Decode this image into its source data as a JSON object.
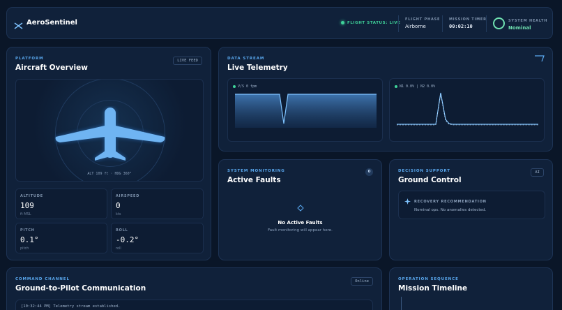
{
  "header": {
    "brand": "AeroSentinel",
    "flight_status": "FLIGHT STATUS: LIVE",
    "flight_phase_label": "FLIGHT PHASE",
    "flight_phase_value": "Airborne",
    "mission_timer_label": "MISSION TIMER",
    "mission_timer_value": "00:02:10",
    "system_health_label": "SYSTEM HEALTH",
    "system_health_value": "Nominal"
  },
  "aircraft": {
    "eyebrow": "PLATFORM",
    "title": "Aircraft Overview",
    "badge": "LIVE FEED",
    "readout": "ALT 109 ft · HDG 360°",
    "stats": [
      {
        "label": "ALTITUDE",
        "value": "109",
        "unit": "ft MSL"
      },
      {
        "label": "AIRSPEED",
        "value": "0",
        "unit": "kts"
      },
      {
        "label": "PITCH",
        "value": "0.1°",
        "unit": "pitch"
      },
      {
        "label": "ROLL",
        "value": "-0.2°",
        "unit": "roll"
      }
    ]
  },
  "telemetry": {
    "eyebrow": "DATA STREAM",
    "title": "Live Telemetry",
    "vs_label": "V/S 0 fpm",
    "n1n2_label": "N1 0.0% | N2 0.0%"
  },
  "faults": {
    "eyebrow": "SYSTEM MONITORING",
    "title": "Active Faults",
    "count": "0",
    "empty_title": "No Active Faults",
    "empty_subtitle": "Fault monitoring will appear here."
  },
  "decision": {
    "eyebrow": "DECISION SUPPORT",
    "title": "Ground Control",
    "badge": "AI",
    "rec_title": "RECOVERY RECOMMENDATION",
    "rec_text": "Nominal ops. No anomalies detected."
  },
  "comms": {
    "eyebrow": "COMMAND CHANNEL",
    "title": "Ground-to-Pilot Communication",
    "badge": "Online",
    "log_line": "[10:32:44 PM] Telemetry stream established."
  },
  "timeline": {
    "eyebrow": "OPERATION SEQUENCE",
    "title": "Mission Timeline"
  },
  "colors": {
    "accent": "#5aa9f0",
    "status_green": "#3fd39a",
    "health_green": "#6fe0b0"
  }
}
